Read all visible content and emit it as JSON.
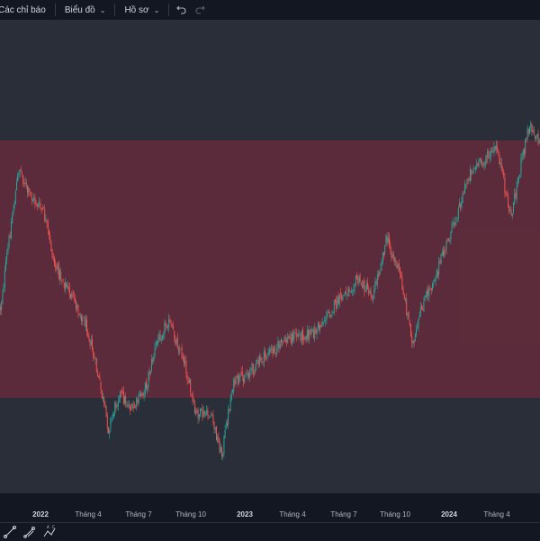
{
  "toolbar": {
    "indicators_label": "Các chỉ báo",
    "chart_label": "Biểu đồ",
    "profile_label": "Hồ sơ",
    "undo_icon": "undo-icon",
    "redo_icon": "redo-icon"
  },
  "time_axis": {
    "labels": [
      "2022",
      "Tháng 4",
      "Tháng 7",
      "Tháng 10",
      "2023",
      "Tháng 4",
      "Tháng 7",
      "Tháng 10",
      "2024",
      "Tháng 4"
    ]
  },
  "drawing_tools": [
    "trend-line-icon",
    "pitchfork-icon",
    "abcd-pattern-icon"
  ],
  "colors": {
    "up": "#26a69a",
    "down": "#ef5350",
    "zone_fill": "#6e2b3c",
    "background": "#2a2e39",
    "panel": "#131722"
  },
  "chart_data": {
    "type": "candlestick",
    "x_ticks": [
      "2022",
      "Tháng 4",
      "Tháng 7",
      "Tháng 10",
      "2023",
      "Tháng 4",
      "Tháng 7",
      "Tháng 10",
      "2024",
      "Tháng 4"
    ],
    "price_path": [
      {
        "x": 0.0,
        "p": 0.35
      },
      {
        "x": 0.02,
        "p": 0.68
      },
      {
        "x": 0.035,
        "p": 0.9
      },
      {
        "x": 0.05,
        "p": 0.8
      },
      {
        "x": 0.08,
        "p": 0.72
      },
      {
        "x": 0.1,
        "p": 0.52
      },
      {
        "x": 0.13,
        "p": 0.4
      },
      {
        "x": 0.16,
        "p": 0.28
      },
      {
        "x": 0.185,
        "p": 0.04
      },
      {
        "x": 0.2,
        "p": -0.12
      },
      {
        "x": 0.22,
        "p": 0.02
      },
      {
        "x": 0.245,
        "p": -0.05
      },
      {
        "x": 0.27,
        "p": 0.05
      },
      {
        "x": 0.29,
        "p": 0.22
      },
      {
        "x": 0.31,
        "p": 0.3
      },
      {
        "x": 0.34,
        "p": 0.15
      },
      {
        "x": 0.36,
        "p": -0.06
      },
      {
        "x": 0.39,
        "p": -0.07
      },
      {
        "x": 0.41,
        "p": -0.22
      },
      {
        "x": 0.43,
        "p": 0.05
      },
      {
        "x": 0.46,
        "p": 0.1
      },
      {
        "x": 0.5,
        "p": 0.18
      },
      {
        "x": 0.54,
        "p": 0.24
      },
      {
        "x": 0.58,
        "p": 0.25
      },
      {
        "x": 0.62,
        "p": 0.36
      },
      {
        "x": 0.66,
        "p": 0.46
      },
      {
        "x": 0.69,
        "p": 0.4
      },
      {
        "x": 0.715,
        "p": 0.62
      },
      {
        "x": 0.74,
        "p": 0.48
      },
      {
        "x": 0.765,
        "p": 0.2
      },
      {
        "x": 0.78,
        "p": 0.35
      },
      {
        "x": 0.81,
        "p": 0.5
      },
      {
        "x": 0.84,
        "p": 0.68
      },
      {
        "x": 0.87,
        "p": 0.88
      },
      {
        "x": 0.9,
        "p": 0.93
      },
      {
        "x": 0.92,
        "p": 0.97
      },
      {
        "x": 0.945,
        "p": 0.7
      },
      {
        "x": 0.965,
        "p": 0.92
      },
      {
        "x": 0.98,
        "p": 1.07
      },
      {
        "x": 1.0,
        "p": 0.98
      }
    ],
    "zone": {
      "lower": 0.0,
      "upper": 1.0
    },
    "grid": false,
    "legend": "none"
  }
}
